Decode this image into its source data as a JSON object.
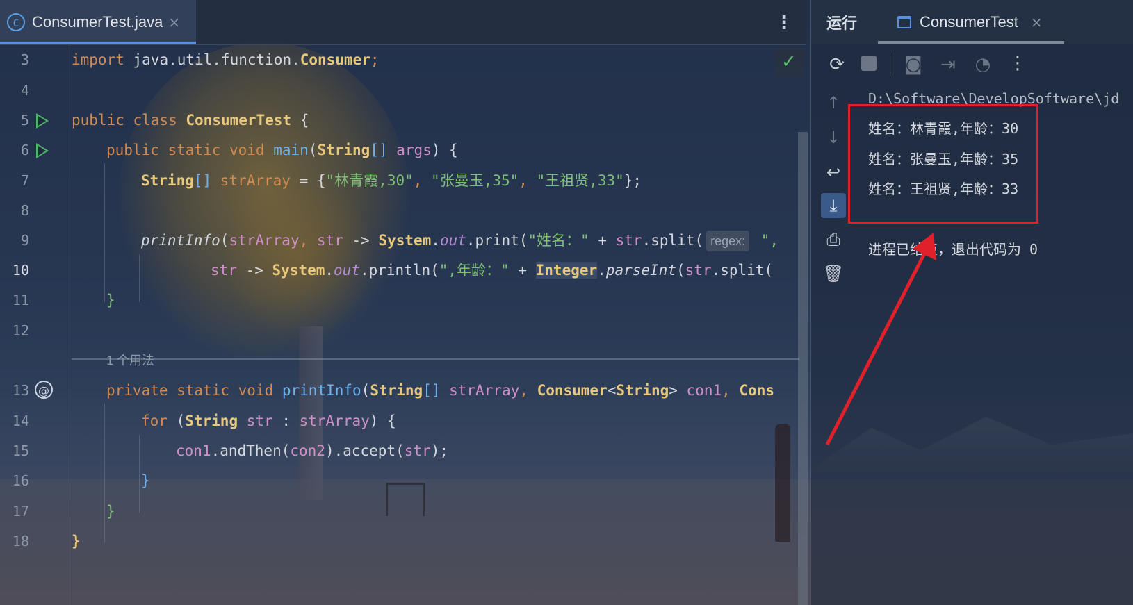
{
  "editor": {
    "tab": {
      "icon": "java-class-icon",
      "label": "ConsumerTest.java",
      "close": "×"
    },
    "menu": "⋮",
    "lines": [
      {
        "num": "3"
      },
      {
        "num": "4"
      },
      {
        "num": "5"
      },
      {
        "num": "6"
      },
      {
        "num": "7"
      },
      {
        "num": "8"
      },
      {
        "num": "9"
      },
      {
        "num": "10"
      },
      {
        "num": "11"
      },
      {
        "num": "12"
      },
      {
        "num": "13"
      },
      {
        "num": "14"
      },
      {
        "num": "15"
      },
      {
        "num": "16"
      },
      {
        "num": "17"
      },
      {
        "num": "18"
      }
    ],
    "code": {
      "l3_kw": "import",
      "l3_pkg": "java.util.function.",
      "l3_cls": "Consumer",
      "l3_end": ";",
      "l5_kw": "public class",
      "l5_cls": "ConsumerTest",
      "l5_end": " {",
      "l6_kw": "public static void",
      "l6_fn": "main",
      "l6_p1": "(",
      "l6_cls": "String",
      "l6_p2": "[] ",
      "l6_var": "args",
      "l6_end": ") {",
      "l7_cls": "String",
      "l7_a": "[] ",
      "l7_var": "strArray",
      "l7_b": " = {",
      "l7_s1": "\"林青霞,30\"",
      "l7_c1": ", ",
      "l7_s2": "\"张曼玉,35\"",
      "l7_c2": ", ",
      "l7_s3": "\"王祖贤,33\"",
      "l7_end": "};",
      "l9_fn": "printInfo",
      "l9_a": "(",
      "l9_var": "strArray",
      "l9_b": ", ",
      "l9_p": "str",
      "l9_c": " -> ",
      "l9_sys": "System",
      "l9_d": ".",
      "l9_out": "out",
      "l9_e": ".print(",
      "l9_s": "\"姓名：\"",
      "l9_f": " + ",
      "l9_p2": "str",
      "l9_g": ".split(",
      "l9_hint": "regex:",
      "l9_h": " \",",
      "l10_p": "str",
      "l10_a": " -> ",
      "l10_sys": "System",
      "l10_b": ".",
      "l10_out": "out",
      "l10_c": ".println(",
      "l10_s": "\",年龄：\"",
      "l10_d": " + ",
      "l10_cls": "Integer",
      "l10_e": ".",
      "l10_fn": "parseInt",
      "l10_f": "(",
      "l10_p2": "str",
      "l10_g": ".split(",
      "l11": "}",
      "usage": "1 个用法",
      "l13_kw": "private static void",
      "l13_fn": "printInfo",
      "l13_a": "(",
      "l13_cls": "String",
      "l13_b": "[] ",
      "l13_var": "strArray",
      "l13_c": ", ",
      "l13_cls2": "Consumer",
      "l13_d": "<",
      "l13_cls3": "String",
      "l13_e": "> ",
      "l13_var2": "con1",
      "l13_f": ", ",
      "l13_cls4": "Cons",
      "l14_kw": "for",
      "l14_a": " (",
      "l14_cls": "String",
      "l14_b": " ",
      "l14_var": "str",
      "l14_c": " : ",
      "l14_var2": "strArray",
      "l14_end": ") {",
      "l15_var": "con1",
      "l15_a": ".andThen(",
      "l15_var2": "con2",
      "l15_b": ").accept(",
      "l15_var3": "str",
      "l15_end": ");",
      "l16": "}",
      "l17": "}",
      "l18": "}"
    }
  },
  "run_panel": {
    "title": "运行",
    "tab_label": "ConsumerTest",
    "tab_close": "×",
    "console": {
      "path": "D:\\Software\\DevelopSoftware\\jd",
      "lines": [
        "姓名：林青霞,年龄：30",
        "姓名：张曼玉,年龄：35",
        "姓名：王祖贤,年龄：33"
      ],
      "exit": "进程已结束，退出代码为 0"
    }
  },
  "colors": {
    "highlight_box": "#e0202a",
    "accent": "#5a8fe0",
    "run_green": "#4cb36a"
  }
}
